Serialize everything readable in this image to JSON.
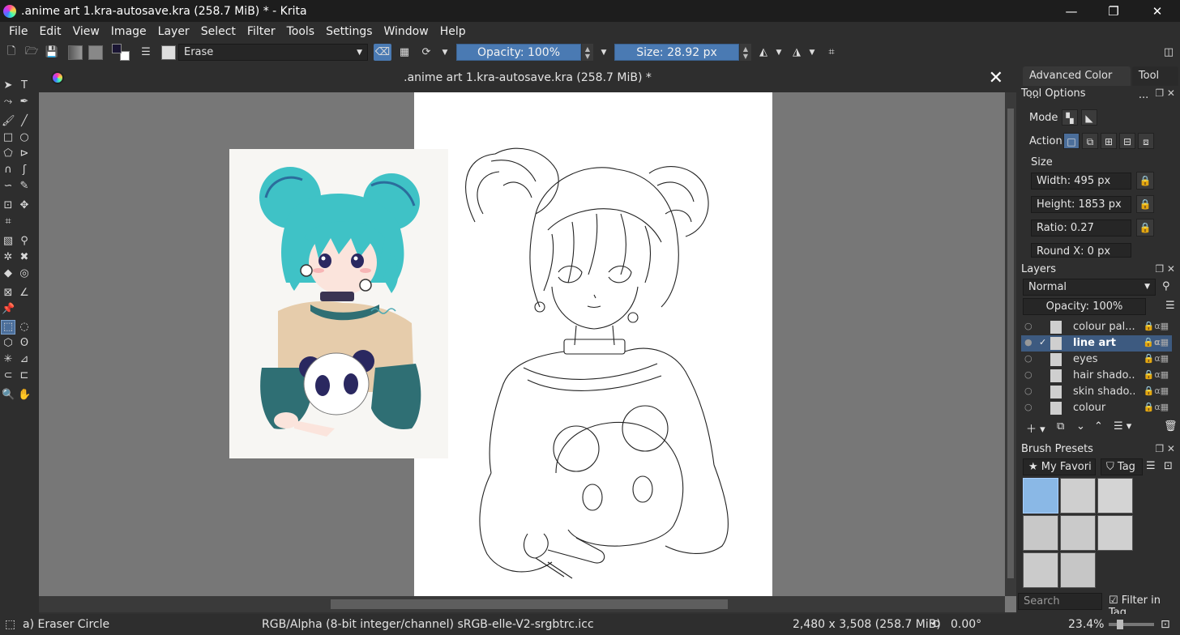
{
  "window": {
    "title": ".anime art 1.kra-autosave.kra (258.7 MiB) * - Krita",
    "minimize": "—",
    "restore": "❐",
    "close": "✕"
  },
  "menu": [
    "File",
    "Edit",
    "View",
    "Image",
    "Layer",
    "Select",
    "Filter",
    "Tools",
    "Settings",
    "Window",
    "Help"
  ],
  "toolbar": {
    "brush_preset": "Erase",
    "opacity": "Opacity: 100%",
    "size": "Size: 28.92 px"
  },
  "document": {
    "tab_title": ".anime art 1.kra-autosave.kra (258.7 MiB) *",
    "close": "✕"
  },
  "dock": {
    "tabs": [
      "Advanced Color ...",
      "Tool ..."
    ],
    "tool_options": {
      "title": "Tool Options",
      "mode_label": "Mode",
      "action_label": "Action",
      "size_label": "Size",
      "width": "Width: 495 px",
      "height": "Height: 1853 px",
      "ratio": "Ratio: 0.27",
      "round_x": "Round X: 0 px"
    },
    "layers": {
      "title": "Layers",
      "blend_mode": "Normal",
      "opacity": "Opacity:  100%",
      "items": [
        {
          "name": "colour pal...",
          "visible": false,
          "active": false
        },
        {
          "name": "line art",
          "visible": true,
          "active": true
        },
        {
          "name": "eyes",
          "visible": false,
          "active": false
        },
        {
          "name": "hair shado...",
          "visible": false,
          "active": false
        },
        {
          "name": "skin shado...",
          "visible": false,
          "active": false
        },
        {
          "name": "colour",
          "visible": false,
          "active": false
        }
      ]
    },
    "brush_presets": {
      "title": "Brush Presets",
      "tag_filter": "My Favori",
      "tag_button": "Tag",
      "search_placeholder": "Search",
      "filter_in_tag": "Filter in Tag"
    }
  },
  "status": {
    "brush": "a) Eraser Circle",
    "color_model": "RGB/Alpha (8-bit integer/channel)  sRGB-elle-V2-srgbtrc.icc",
    "image_size": "2,480 x 3,508 (258.7 MiB)",
    "rotation": "0.00°",
    "zoom": "23.4%"
  },
  "colors": {
    "accent": "#4a7ab3",
    "panel": "#2e2e2e",
    "canvas_bg": "#777777",
    "hair": "#3fc2c6",
    "sweater": "#e6ccab",
    "sleeve": "#2f6f74"
  }
}
